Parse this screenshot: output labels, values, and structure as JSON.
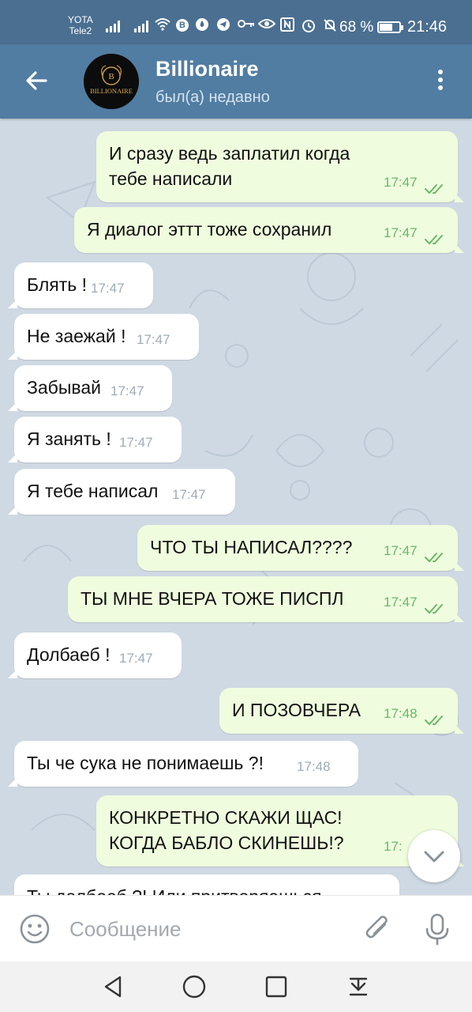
{
  "status_bar": {
    "carrier_1": "YOTA",
    "carrier_2": "Tele2",
    "battery_percent": "68 %",
    "battery_level": 0.68,
    "time": "21:46",
    "icons": [
      "signal-icon",
      "signal-icon",
      "wifi-icon",
      "b-icon",
      "flame-icon",
      "telegram-icon",
      "key-icon",
      "eye-icon",
      "nfc-icon",
      "alarm-icon",
      "mute-icon",
      "battery-icon"
    ]
  },
  "header": {
    "title": "Billionaire",
    "subtitle": "был(а) недавно",
    "avatar_text": "BILLIONAIRE",
    "avatar_letter": "B"
  },
  "messages": [
    {
      "dir": "out",
      "text": "И сразу ведь заплатил когда тебе написали",
      "time": "17:47",
      "read": true
    },
    {
      "dir": "out",
      "text": "Я диалог эттт тоже сохранил",
      "time": "17:47",
      "read": true
    },
    {
      "dir": "in",
      "text": "Блять !",
      "time": "17:47"
    },
    {
      "dir": "in",
      "text": "Не заежай !",
      "time": "17:47"
    },
    {
      "dir": "in",
      "text": "Забывай",
      "time": "17:47"
    },
    {
      "dir": "in",
      "text": "Я занять !",
      "time": "17:47"
    },
    {
      "dir": "in",
      "text": "Я тебе написал",
      "time": "17:47"
    },
    {
      "dir": "out",
      "text": "ЧТО ТЫ НАПИСАЛ????",
      "time": "17:47",
      "read": true
    },
    {
      "dir": "out",
      "text": "ТЫ МНЕ ВЧЕРА ТОЖЕ ПИСПЛ",
      "time": "17:47",
      "read": true
    },
    {
      "dir": "in",
      "text": "Долбаеб !",
      "time": "17:47"
    },
    {
      "dir": "out",
      "text": "И ПОЗОВЧЕРА",
      "time": "17:48",
      "read": true
    },
    {
      "dir": "in",
      "text": "Ты че сука не понимаешь ?!",
      "time": "17:48"
    },
    {
      "dir": "out",
      "text": "КОНКРЕТНО СКАЖИ ЩАС! КОГДА БАБЛО СКИНЕШЬ!?",
      "time": "17:",
      "read": true
    },
    {
      "dir": "in",
      "text": "Ты долбоеб ?! Или притворяешься ?!",
      "time": ""
    }
  ],
  "input": {
    "placeholder": "Сообщение"
  },
  "colors": {
    "status_bar": "#4b6f91",
    "header": "#517da2",
    "chat_bg": "#cfd9e3",
    "bubble_in": "#ffffff",
    "bubble_out": "#effdde",
    "time_out": "#6cb66a",
    "time_in": "#a0acb6"
  },
  "nav": {
    "buttons": [
      "back-nav-icon",
      "home-nav-icon",
      "recents-nav-icon",
      "notifications-nav-icon"
    ]
  }
}
